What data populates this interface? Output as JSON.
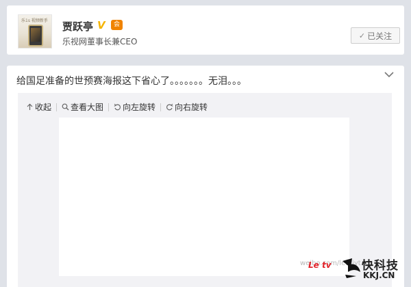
{
  "profile": {
    "avatar_text": "乐1s 视频新手",
    "name": "贾跃亭",
    "verified_mark": "V",
    "vip_mark": "会员",
    "description": "乐视网董事长兼CEO",
    "follow_label": "已关注",
    "follow_icon": "check-icon"
  },
  "post": {
    "text": "给国足准备的世预赛海报这下省心了。。。。。。。无泪。。。",
    "expand_icon": "chevron-down-icon",
    "toolbar": [
      {
        "label": "收起",
        "icon": "collapse-up-icon"
      },
      {
        "label": "查看大图",
        "icon": "search-icon"
      },
      {
        "label": "向左旋转",
        "icon": "rotate-left-icon"
      },
      {
        "label": "向右旋转",
        "icon": "rotate-right-icon"
      }
    ],
    "image_watermark": "weibo.com/letvjyt",
    "image_brand": "Le tv"
  },
  "site_logo": {
    "title": "快科技",
    "url": "KKJ.CN"
  }
}
